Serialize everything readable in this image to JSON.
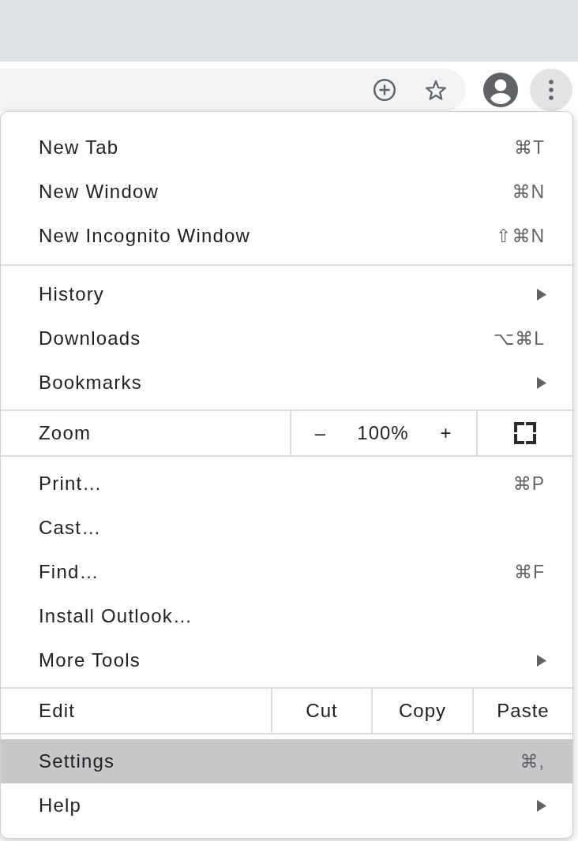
{
  "menu_button": {
    "pressed": true
  },
  "menu": {
    "sections": [
      {
        "kind": "items",
        "items": [
          {
            "label": "New Tab",
            "shortcut": "⌘T",
            "submenu": false,
            "selected": false
          },
          {
            "label": "New Window",
            "shortcut": "⌘N",
            "submenu": false,
            "selected": false
          },
          {
            "label": "New Incognito Window",
            "shortcut": "⇧⌘N",
            "submenu": false,
            "selected": false
          }
        ]
      },
      {
        "kind": "items",
        "items": [
          {
            "label": "History",
            "submenu": true,
            "selected": false
          },
          {
            "label": "Downloads",
            "shortcut": "⌥⌘L",
            "submenu": false,
            "selected": false
          },
          {
            "label": "Bookmarks",
            "submenu": true,
            "selected": false
          }
        ]
      },
      {
        "kind": "zoom",
        "label": "Zoom",
        "zoom_out": "–",
        "value": "100%",
        "zoom_in": "+"
      },
      {
        "kind": "items",
        "items": [
          {
            "label": "Print…",
            "shortcut": "⌘P",
            "submenu": false,
            "selected": false
          },
          {
            "label": "Cast…",
            "submenu": false,
            "selected": false
          },
          {
            "label": "Find…",
            "shortcut": "⌘F",
            "submenu": false,
            "selected": false
          },
          {
            "label": "Install Outlook…",
            "submenu": false,
            "selected": false
          },
          {
            "label": "More Tools",
            "submenu": true,
            "selected": false
          }
        ]
      },
      {
        "kind": "edit",
        "label": "Edit",
        "actions": [
          "Cut",
          "Copy",
          "Paste"
        ]
      },
      {
        "kind": "items",
        "items": [
          {
            "label": "Settings",
            "shortcut": "⌘,",
            "submenu": false,
            "selected": true
          },
          {
            "label": "Help",
            "submenu": true,
            "selected": false
          }
        ]
      }
    ]
  }
}
